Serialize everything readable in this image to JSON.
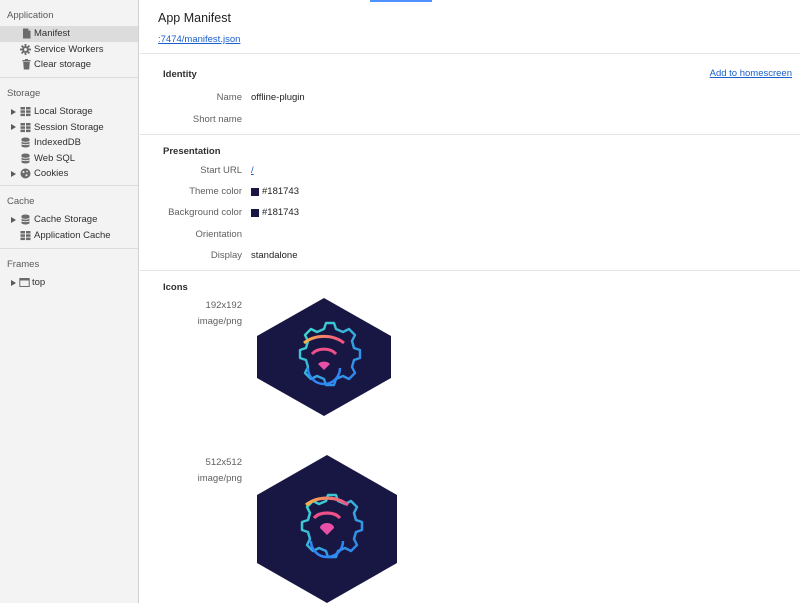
{
  "sidebar": {
    "sections": [
      {
        "title": "Application",
        "items": [
          {
            "label": "Manifest",
            "icon": "document-icon",
            "selected": true
          },
          {
            "label": "Service Workers",
            "icon": "gear-icon"
          },
          {
            "label": "Clear storage",
            "icon": "trash-icon"
          }
        ]
      },
      {
        "title": "Storage",
        "items": [
          {
            "label": "Local Storage",
            "icon": "grid-icon",
            "expandable": true
          },
          {
            "label": "Session Storage",
            "icon": "grid-icon",
            "expandable": true
          },
          {
            "label": "IndexedDB",
            "icon": "database-icon"
          },
          {
            "label": "Web SQL",
            "icon": "database-icon"
          },
          {
            "label": "Cookies",
            "icon": "cookie-icon",
            "expandable": true
          }
        ]
      },
      {
        "title": "Cache",
        "items": [
          {
            "label": "Cache Storage",
            "icon": "database-icon",
            "expandable": true
          },
          {
            "label": "Application Cache",
            "icon": "grid-icon"
          }
        ]
      },
      {
        "title": "Frames",
        "items": [
          {
            "label": "top",
            "icon": "frame-icon",
            "expandable": true
          }
        ]
      }
    ]
  },
  "main": {
    "title": "App Manifest",
    "manifest_url": ":7474/manifest.json",
    "identity": {
      "title": "Identity",
      "add_to_homescreen": "Add to homescreen",
      "name_label": "Name",
      "name_value": "offline-plugin",
      "short_name_label": "Short name",
      "short_name_value": ""
    },
    "presentation": {
      "title": "Presentation",
      "start_url_label": "Start URL",
      "start_url_value": "/",
      "theme_color_label": "Theme color",
      "theme_color_value": "#181743",
      "background_color_label": "Background color",
      "background_color_value": "#181743",
      "orientation_label": "Orientation",
      "orientation_value": "",
      "display_label": "Display",
      "display_value": "standalone"
    },
    "icons": {
      "title": "Icons",
      "list": [
        {
          "size": "192x192",
          "type": "image/png"
        },
        {
          "size": "512x512",
          "type": "image/png"
        }
      ]
    }
  },
  "colors": {
    "link": "#1a5fcf",
    "icon_background": "#181743",
    "sidebar_bg": "#f3f3f3",
    "selected_bg": "#dcdcdc"
  }
}
